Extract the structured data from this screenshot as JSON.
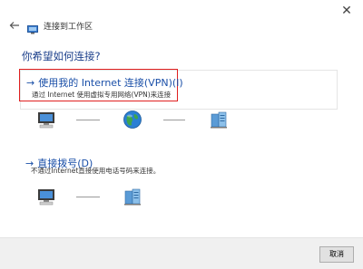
{
  "window": {
    "title": "连接到工作区",
    "close_glyph": "✕"
  },
  "question": "你希望如何连接?",
  "options": [
    {
      "title": "使用我的 Internet 连接(VPN)(I)",
      "description": "通过 Internet 使用虚拟专用网络(VPN)来连接",
      "arrow": "→"
    },
    {
      "title": "直接拨号(D)",
      "description": "不通过Internet直接使用电话号码来连接。",
      "arrow": "→"
    }
  ],
  "footer": {
    "cancel_label": "取消"
  },
  "icons": {
    "back": "back-arrow-icon",
    "app": "network-icon",
    "computer": "computer-icon",
    "globe": "globe-icon",
    "server": "server-icon"
  },
  "colors": {
    "link_blue": "#1a4fa8",
    "heading_blue": "#1a3e8a",
    "highlight_red": "#e02020",
    "footer_bg": "#f0f0f0"
  }
}
